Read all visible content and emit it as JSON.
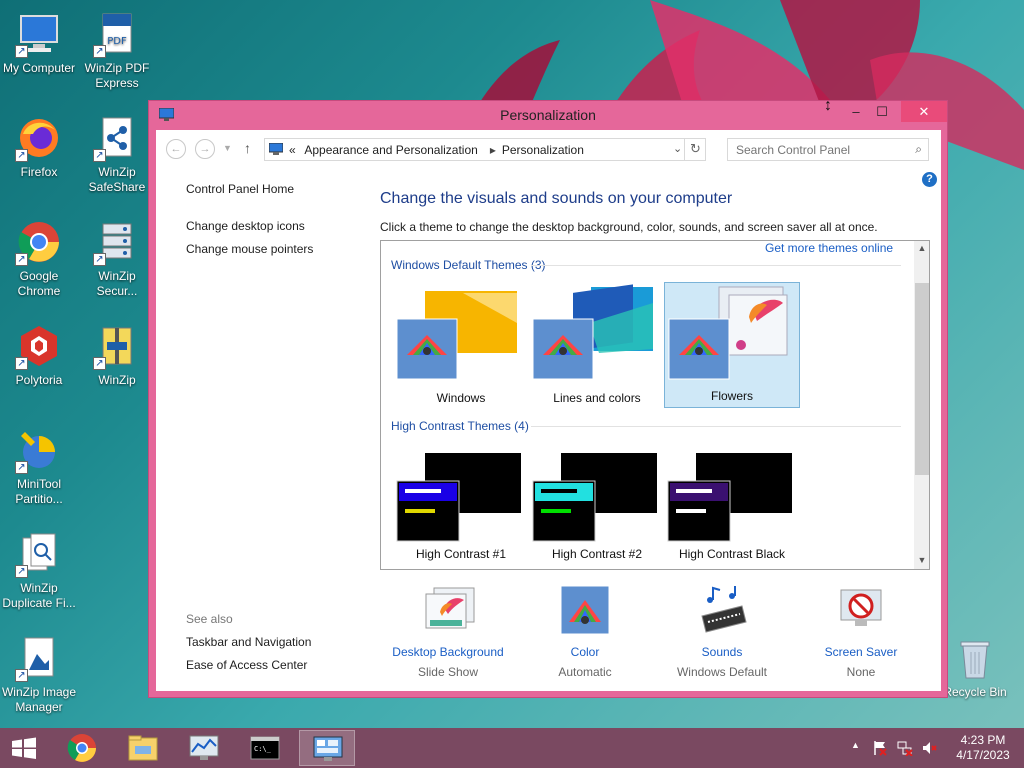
{
  "window": {
    "title": "Personalization",
    "minimize": "–",
    "maximize": "☐",
    "close": "✕"
  },
  "address": {
    "back": "←",
    "forward": "→",
    "up": "↑",
    "overflow": "«",
    "crumbs": [
      "Appearance and Personalization",
      "Personalization"
    ],
    "separator": "▸",
    "search_placeholder": "Search Control Panel"
  },
  "left_pane": {
    "home": "Control Panel Home",
    "links": [
      "Change desktop icons",
      "Change mouse pointers"
    ],
    "see_also_label": "See also",
    "see_also": [
      "Taskbar and Navigation",
      "Ease of Access Center"
    ]
  },
  "main": {
    "heading": "Change the visuals and sounds on your computer",
    "subheading": "Click a theme to change the desktop background, color, sounds, and screen saver all at once.",
    "get_more": "Get more themes online",
    "groups": [
      {
        "title": "Windows Default Themes (3)",
        "themes": [
          "Windows",
          "Lines and colors",
          "Flowers"
        ],
        "selected": "Flowers"
      },
      {
        "title": "High Contrast Themes (4)",
        "themes": [
          "High Contrast #1",
          "High Contrast #2",
          "High Contrast Black"
        ]
      }
    ]
  },
  "bottom": [
    {
      "label": "Desktop Background",
      "value": "Slide Show"
    },
    {
      "label": "Color",
      "value": "Automatic"
    },
    {
      "label": "Sounds",
      "value": "Windows Default"
    },
    {
      "label": "Screen Saver",
      "value": "None"
    }
  ],
  "desktop_icons": [
    {
      "label": "My Computer",
      "icon": "computer-icon"
    },
    {
      "label": "WinZip PDF Express",
      "icon": "pdf-icon"
    },
    {
      "label": "Firefox",
      "icon": "firefox-icon"
    },
    {
      "label": "WinZip SafeShare",
      "icon": "share-icon"
    },
    {
      "label": "Google Chrome",
      "icon": "chrome-icon"
    },
    {
      "label": "WinZip Secur...",
      "icon": "server-icon"
    },
    {
      "label": "Polytoria",
      "icon": "polytoria-icon"
    },
    {
      "label": "WinZip",
      "icon": "winzip-icon"
    },
    {
      "label": "MiniTool Partitio...",
      "icon": "minitool-icon"
    },
    {
      "label": "WinZip Duplicate Fi...",
      "icon": "duplicate-icon"
    },
    {
      "label": "WinZip Image Manager",
      "icon": "image-manager-icon"
    },
    {
      "label": "Recycle Bin",
      "icon": "recycle-bin-icon"
    }
  ],
  "taskbar": {
    "time": "4:23 PM",
    "date": "4/17/2023",
    "tray_chevron": "▲"
  },
  "colors": {
    "window_frame": "#e5679a",
    "taskbar": "#7a4961",
    "link": "#1a5ec5",
    "heading": "#1e3d8a"
  }
}
